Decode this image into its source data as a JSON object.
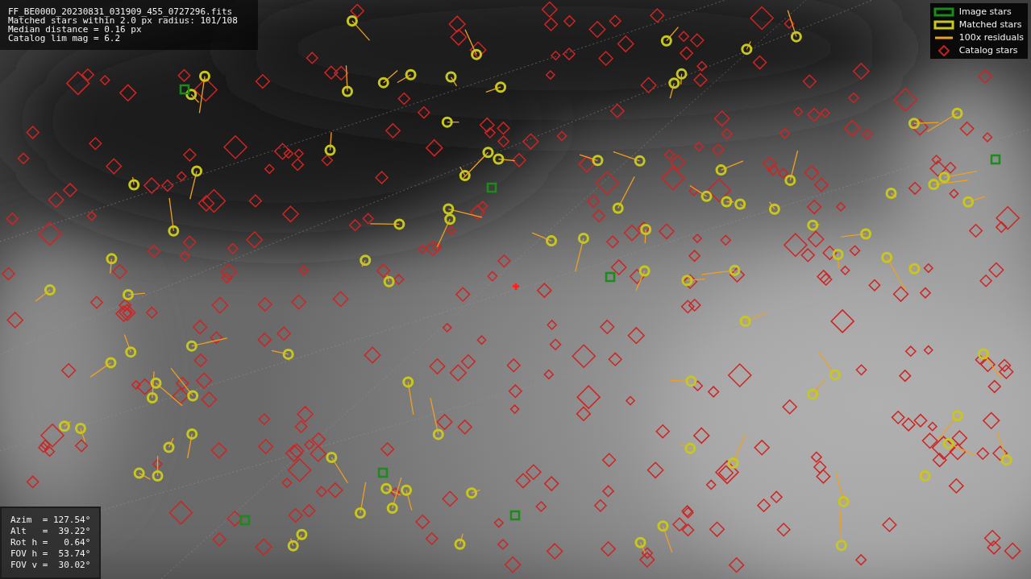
{
  "info": {
    "lines": [
      "FF_BE000D_20230831_031909_455_0727296.fits",
      "Matched stars within 2.0 px radius: 101/108",
      "Median distance = 0.16 px",
      "Catalog lim mag = 6.2"
    ]
  },
  "legend": [
    {
      "label": "Image stars",
      "kind": "box",
      "color": "#1a8c1a"
    },
    {
      "label": "Matched stars",
      "kind": "box",
      "color": "#c8c81a"
    },
    {
      "label": "100x residuals",
      "kind": "line",
      "color": "#f0a020"
    },
    {
      "label": "Catalog stars",
      "kind": "diamond",
      "color": "#c02020"
    }
  ],
  "pointing": {
    "lines": [
      "Azim  = 127.54°",
      "Alt   =  39.22°",
      "Rot h =   0.64°",
      "FOV h =  53.74°",
      "FOV v =  30.02°"
    ]
  }
}
